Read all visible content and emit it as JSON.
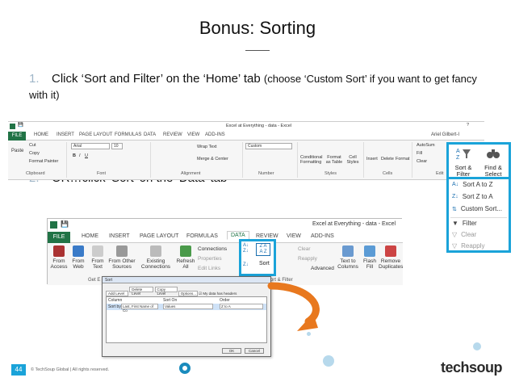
{
  "slide": {
    "title": "Bonus: Sorting",
    "step1": {
      "num": "1.",
      "text": "Click ‘Sort and Filter’ on the ‘Home’ tab",
      "note": "(choose ‘Custom Sort’ if you want to get fancy with it)"
    },
    "step2": {
      "num": "2.",
      "text": "OR…click ‘Sort’ on the ‘Data’ tab"
    }
  },
  "ribbon_home": {
    "window_title": "Excel at Everything - data - Excel",
    "user": "Ariel Gilbert-I",
    "tabs": [
      "FILE",
      "HOME",
      "INSERT",
      "PAGE LAYOUT",
      "FORMULAS",
      "DATA",
      "REVIEW",
      "VIEW",
      "ADD-INS"
    ],
    "clipboard": {
      "cut": "Cut",
      "copy": "Copy",
      "format_painter": "Format Painter",
      "paste": "Paste",
      "group": "Clipboard"
    },
    "font": {
      "name": "Arial",
      "size": "10",
      "group": "Font"
    },
    "alignment": {
      "wrap": "Wrap Text",
      "merge": "Merge & Center",
      "group": "Alignment"
    },
    "number": {
      "format": "Custom",
      "group": "Number"
    },
    "styles": {
      "conditional": "Conditional Formatting",
      "format_table": "Format as Table",
      "cell_styles": "Cell Styles",
      "group": "Styles"
    },
    "cells": {
      "insert": "Insert",
      "delete": "Delete",
      "format": "Format",
      "group": "Cells"
    },
    "editing": {
      "autosum": "AutoSum",
      "fill": "Fill",
      "clear": "Clear",
      "sort_filter": "Sort &\nFilter",
      "find_select": "Find &\nSelect",
      "group": "Edit"
    }
  },
  "sort_menu": {
    "items": [
      {
        "label": "Sort A to Z",
        "icon": "sort-az-icon",
        "dim": false
      },
      {
        "label": "Sort Z to A",
        "icon": "sort-za-icon",
        "dim": false
      },
      {
        "label": "Custom Sort...",
        "icon": "custom-sort-icon",
        "dim": false
      },
      {
        "label": "Filter",
        "icon": "filter-icon",
        "dim": false
      },
      {
        "label": "Clear",
        "icon": "clear-filter-icon",
        "dim": true
      },
      {
        "label": "Reapply",
        "icon": "reapply-icon",
        "dim": true
      }
    ]
  },
  "ribbon_data": {
    "window_title": "Excel at Everything - data - Excel",
    "tabs": [
      "FILE",
      "HOME",
      "INSERT",
      "PAGE LAYOUT",
      "FORMULAS",
      "DATA",
      "REVIEW",
      "VIEW",
      "ADD-INS"
    ],
    "get_external": [
      {
        "label": "From\nAccess"
      },
      {
        "label": "From\nWeb"
      },
      {
        "label": "From\nText"
      },
      {
        "label": "From Other\nSources"
      },
      {
        "label": "Existing\nConnections"
      }
    ],
    "get_external_group": "Get E",
    "refresh": "Refresh\nAll",
    "connections": [
      "Connections",
      "Properties",
      "Edit Links"
    ],
    "sort": "Sort",
    "filter_items": [
      "Clear",
      "Reapply",
      "Advanced"
    ],
    "sort_filter_group": "Sort & Filter",
    "tools": [
      {
        "label": "Text to\nColumns"
      },
      {
        "label": "Flash\nFill"
      },
      {
        "label": "Remove\nDuplicates"
      }
    ]
  },
  "dialog": {
    "title": "Sort",
    "add_level": "Add Level",
    "delete_level": "Delete Level",
    "copy_level": "Copy Level",
    "options": "Options...",
    "header_check": "My data has headers",
    "col_header": "Column",
    "sort_on_header": "Sort On",
    "order_header": "Order",
    "sort_by": "Sort by",
    "column_value": "Last, First Name of Co",
    "sort_on_value": "Values",
    "order_value": "Z to A",
    "ok": "OK",
    "cancel": "Cancel"
  },
  "footer": {
    "page": "44",
    "copyright": "© TechSoup Global | All rights reserved.",
    "logo_a": "tech",
    "logo_b": "soup"
  },
  "colors": {
    "accent": "#1aa3d9",
    "excel_green": "#217346",
    "arrow": "#e8781e"
  }
}
